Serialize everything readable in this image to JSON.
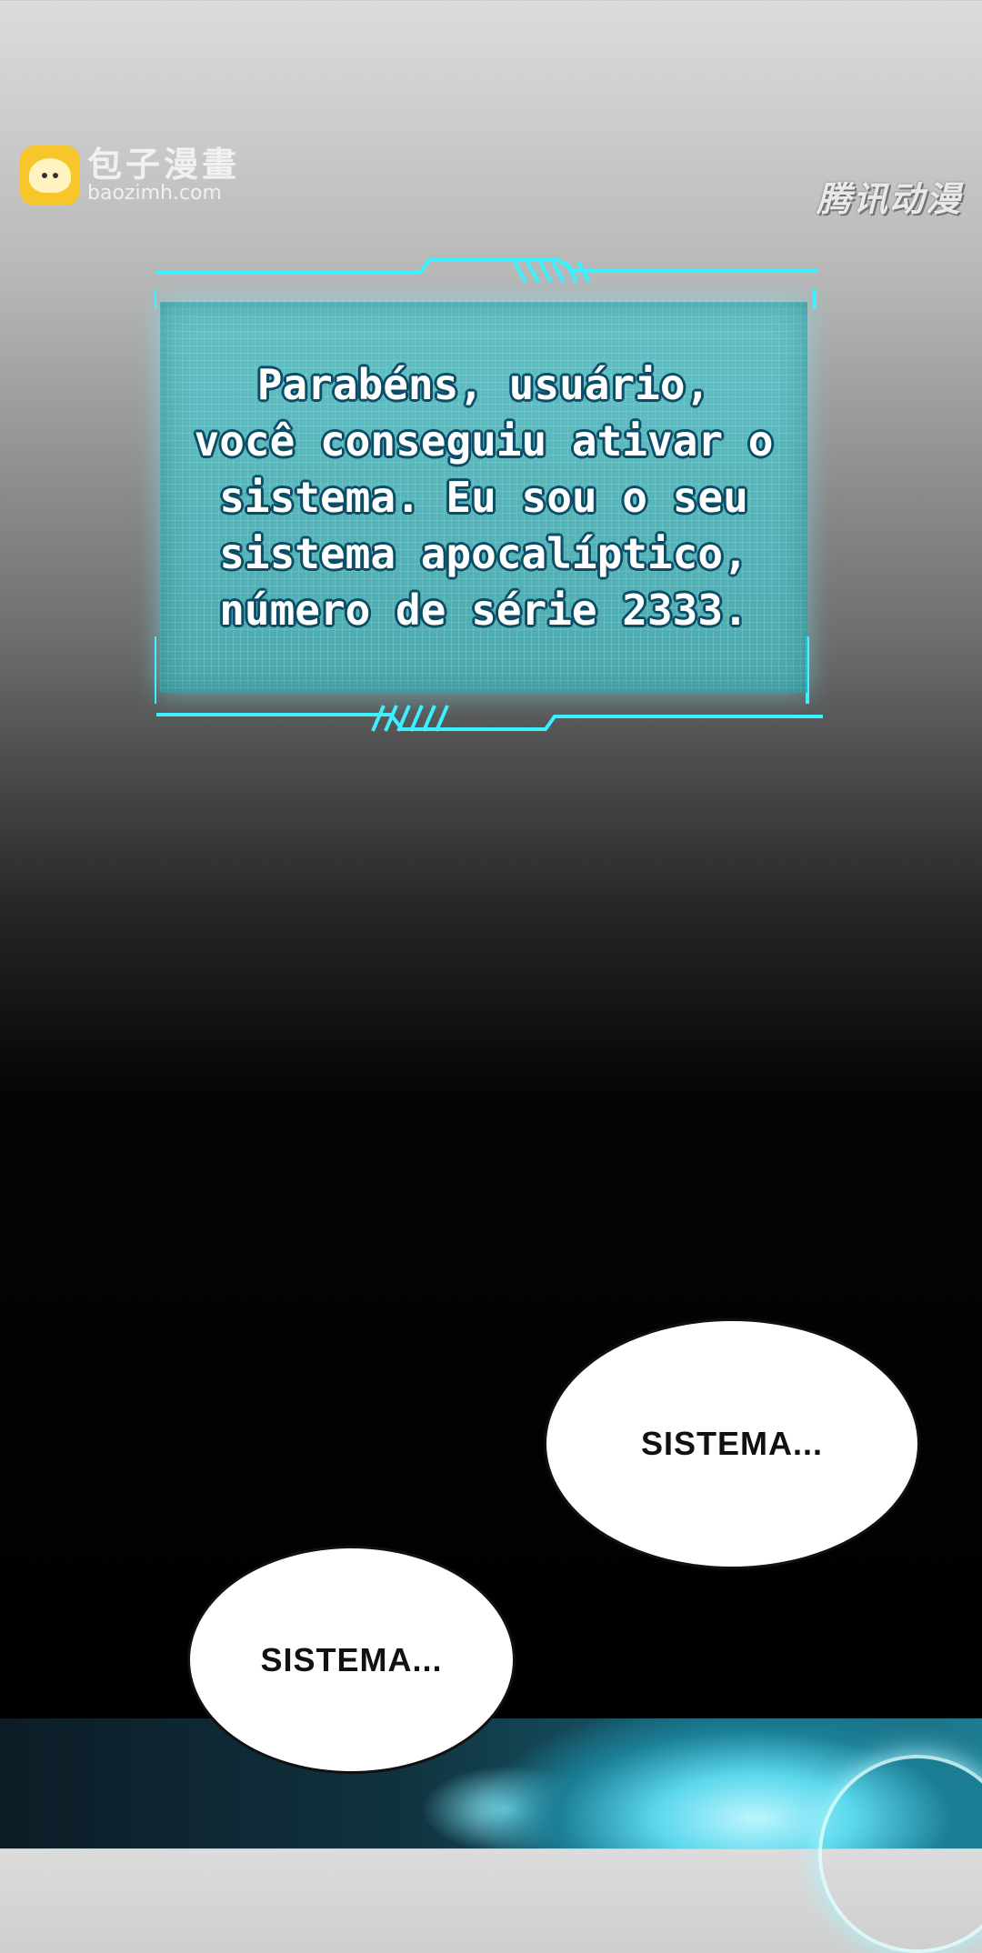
{
  "watermarks": {
    "left_cn": "包子漫畫",
    "left_url": "baozimh.com",
    "right": "腾讯动漫"
  },
  "system_panel": {
    "message": "Parabéns, usuário,\nvocê conseguiu ativar o\nsistema. Eu sou o seu\nsistema apocalíptico,\nnúmero de série 2333."
  },
  "bubbles": [
    {
      "text": "SISTEMA..."
    },
    {
      "text": "SISTEMA..."
    }
  ],
  "colors": {
    "hud_cyan": "#3df0ff",
    "panel_fill": "#40c8cd",
    "text_outline": "#0b4d66"
  }
}
